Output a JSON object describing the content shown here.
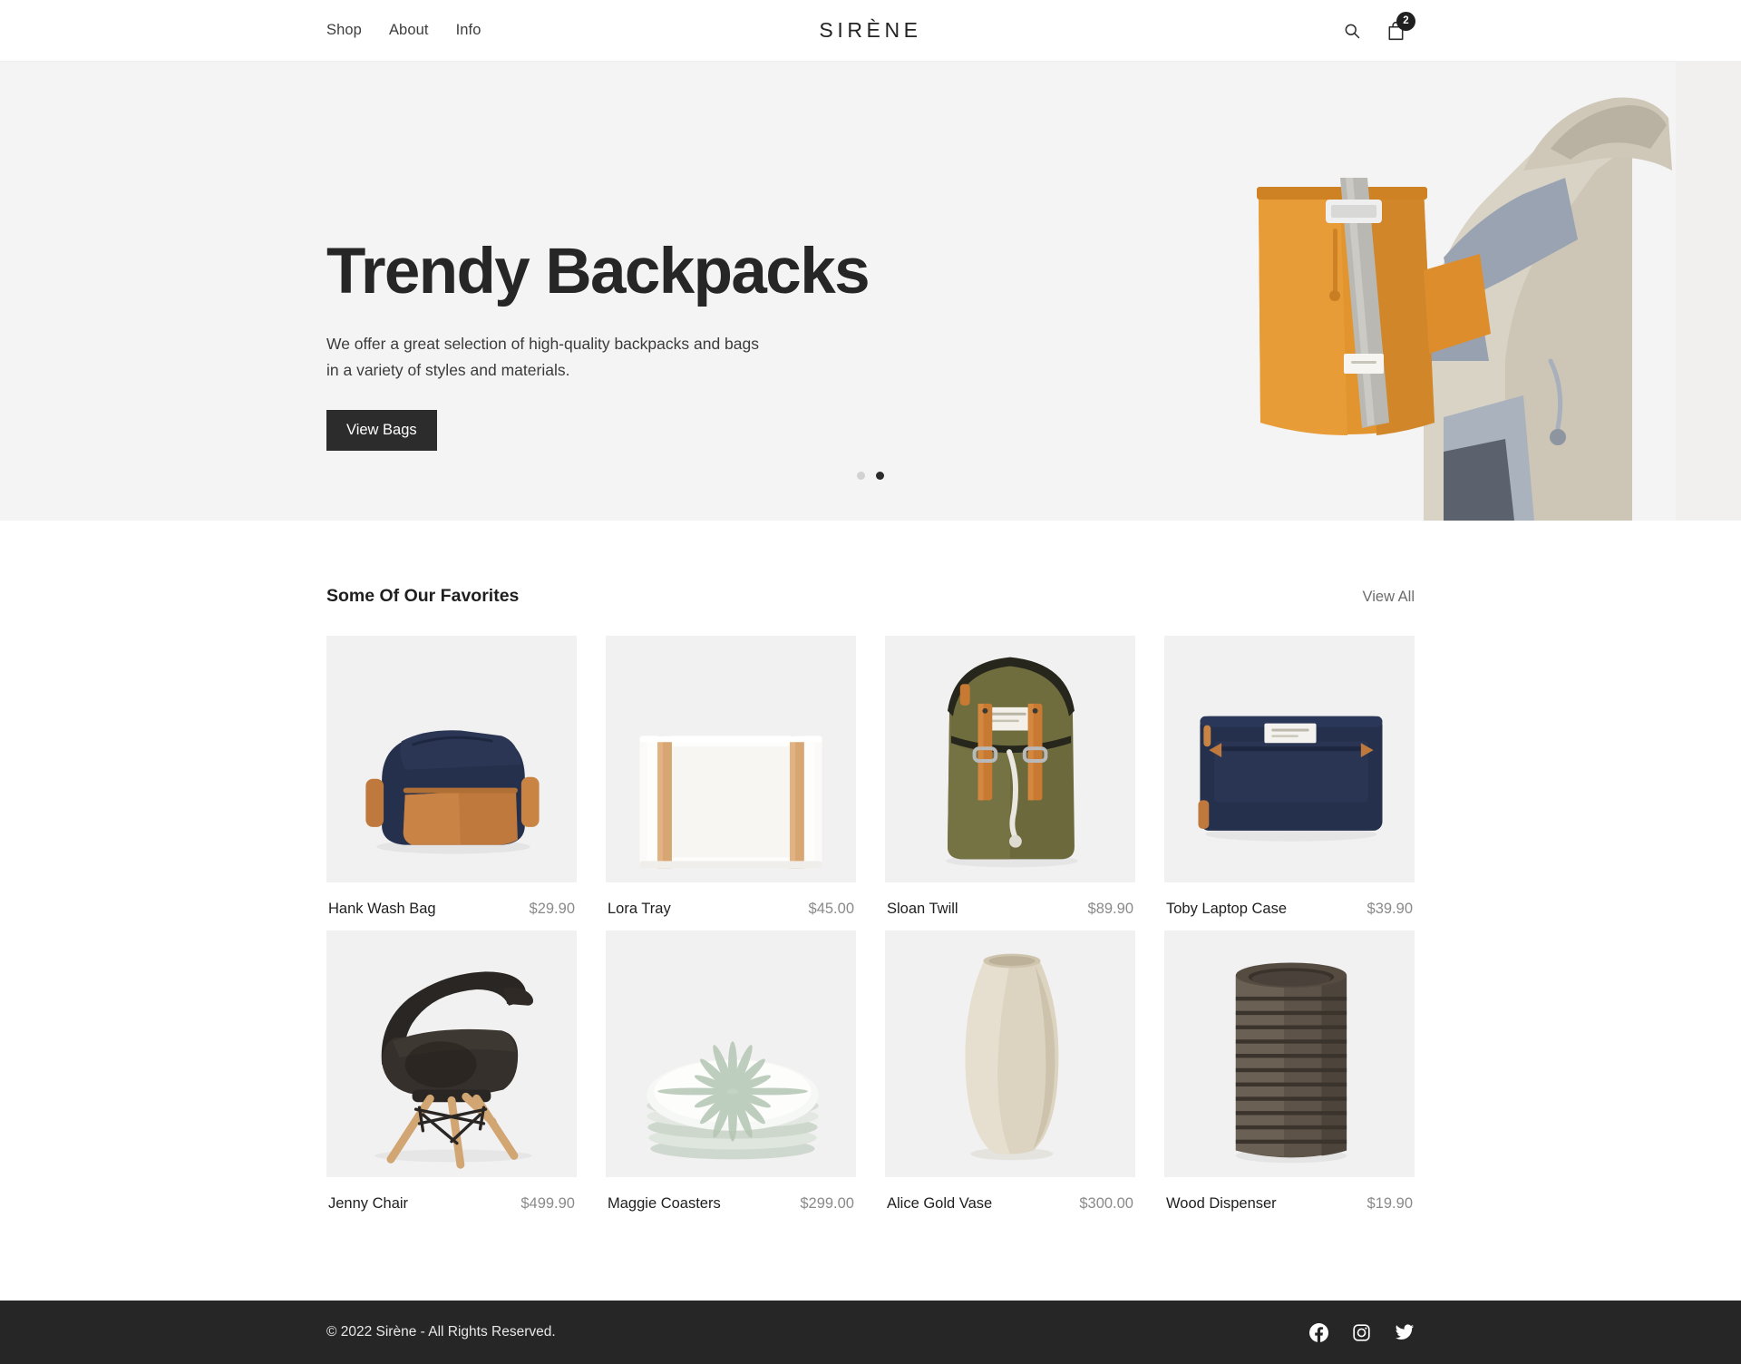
{
  "header": {
    "nav": [
      {
        "label": "Shop"
      },
      {
        "label": "About"
      },
      {
        "label": "Info"
      }
    ],
    "logo": "SIRÈNE",
    "search_icon": "search-icon",
    "cart_icon": "shopping-bag-icon",
    "cart_count": "2"
  },
  "hero": {
    "title": "Trendy Backpacks",
    "subtitle": "We offer a great selection of high-quality backpacks and bags in a variety of styles and materials.",
    "cta_label": "View Bags",
    "slides": [
      {
        "active": false
      },
      {
        "active": true
      }
    ],
    "image_alt": "person-wearing-orange-tote-backpack"
  },
  "favorites": {
    "title": "Some Of Our Favorites",
    "view_all_label": "View All",
    "products": [
      {
        "name": "Hank Wash Bag",
        "price": "$29.90",
        "art": "wash-bag"
      },
      {
        "name": "Lora Tray",
        "price": "$45.00",
        "art": "tray"
      },
      {
        "name": "Sloan Twill",
        "price": "$89.90",
        "art": "backpack"
      },
      {
        "name": "Toby Laptop Case",
        "price": "$39.90",
        "art": "laptop-case"
      },
      {
        "name": "Jenny Chair",
        "price": "$499.90",
        "art": "chair"
      },
      {
        "name": "Maggie Coasters",
        "price": "$299.00",
        "art": "coasters"
      },
      {
        "name": "Alice Gold Vase",
        "price": "$300.00",
        "art": "vase"
      },
      {
        "name": "Wood Dispenser",
        "price": "$19.90",
        "art": "dispenser"
      }
    ]
  },
  "footer": {
    "copyright": "© 2022 Sirène - All Rights Reserved.",
    "socials": [
      {
        "name": "facebook-icon"
      },
      {
        "name": "instagram-icon"
      },
      {
        "name": "twitter-icon"
      }
    ]
  },
  "colors": {
    "dark": "#262626",
    "hero_bg": "#f4f4f4",
    "thumb_bg": "#f1f1f1",
    "price_text": "#8a8a8a",
    "navy": "#25304d",
    "tan": "#c0793c",
    "olive": "#6c6a3c"
  }
}
